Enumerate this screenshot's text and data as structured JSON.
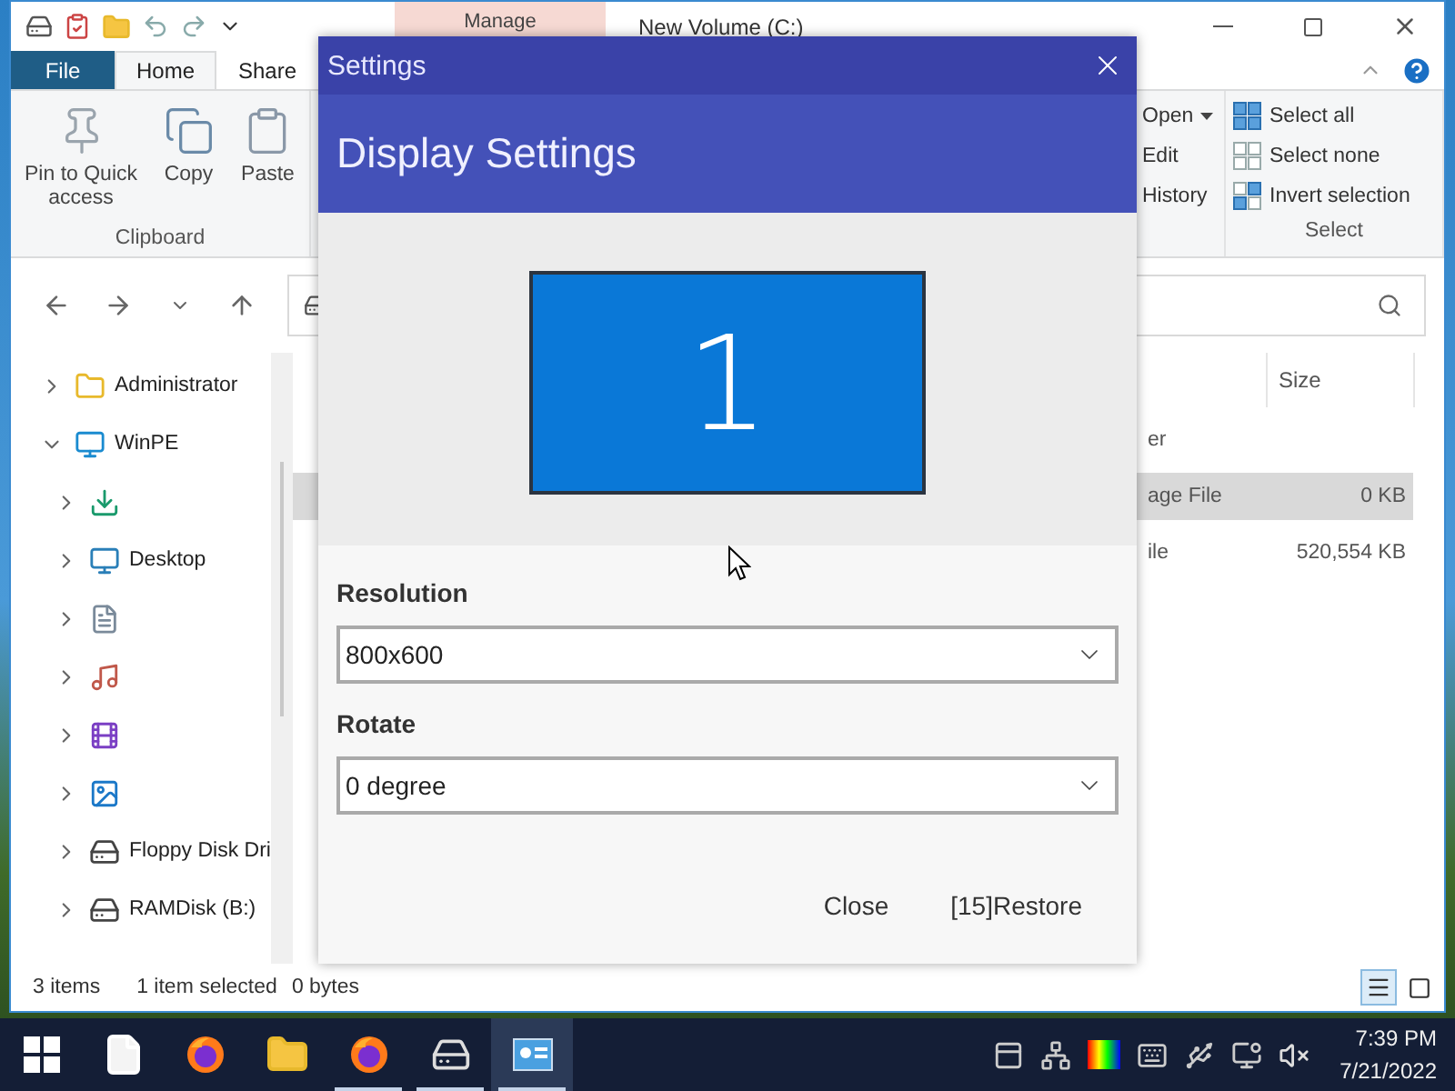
{
  "explorer": {
    "title": "New Volume (C:)",
    "context_tab": "Manage",
    "ribbon_tabs": [
      {
        "label": "File",
        "kind": "backstage",
        "selected": false
      },
      {
        "label": "Home",
        "kind": "tab",
        "selected": true
      },
      {
        "label": "Share",
        "kind": "tab",
        "selected": false
      }
    ],
    "clipboard_group": {
      "name": "Clipboard",
      "buttons": [
        {
          "label": "Pin to Quick access",
          "kind": "pin"
        },
        {
          "label": "Copy",
          "kind": "copy"
        },
        {
          "label": "Paste",
          "kind": "paste"
        }
      ]
    },
    "open_group": {
      "buttons": [
        {
          "label": "Open",
          "kind": "dropdown"
        },
        {
          "label": "Edit",
          "kind": "plain"
        },
        {
          "label": "History",
          "kind": "plain"
        }
      ]
    },
    "select_group": {
      "name": "Select",
      "buttons": [
        {
          "label": "Select all",
          "kind": "all"
        },
        {
          "label": "Select none",
          "kind": "none"
        },
        {
          "label": "Invert selection",
          "kind": "invert"
        }
      ]
    },
    "nav_tree": [
      {
        "label": "Administrator",
        "kind": "folder",
        "expanded": false
      },
      {
        "label": "WinPE",
        "kind": "computer",
        "expanded": true,
        "children": [
          {
            "kind": "downloads",
            "expanded": false
          },
          {
            "label": "Desktop",
            "kind": "desktop",
            "expanded": false
          },
          {
            "kind": "documents",
            "expanded": false
          },
          {
            "kind": "music",
            "expanded": false
          },
          {
            "kind": "videos",
            "expanded": false
          },
          {
            "kind": "pictures",
            "expanded": false
          },
          {
            "label": "Floppy Disk Dri",
            "kind": "floppy",
            "expanded": false
          },
          {
            "label": "RAMDisk (B:)",
            "kind": "drive",
            "expanded": false
          }
        ]
      }
    ],
    "columns": [
      {
        "label": "Size"
      }
    ],
    "rows": [
      {
        "name": "er",
        "selected": false
      },
      {
        "name": "age File",
        "size": "0 KB",
        "selected": true
      },
      {
        "name": "ile",
        "size": "520,554 KB",
        "selected": false
      }
    ],
    "status_bar": {
      "item_count": "3 items",
      "selection": "1 item selected",
      "selection_size": "0 bytes"
    },
    "view_buttons": [
      {
        "kind": "details",
        "selected": true
      },
      {
        "kind": "large-icons",
        "selected": false
      }
    ]
  },
  "dialog": {
    "title": "Settings",
    "heading": "Display Settings",
    "monitor_number": "1",
    "fields": [
      {
        "label": "Resolution",
        "value": "800x600"
      },
      {
        "label": "Rotate",
        "value": "0 degree"
      }
    ],
    "buttons": [
      "Close",
      "[15]Restore"
    ]
  },
  "taskbar": {
    "apps": [
      {
        "kind": "start",
        "running": false,
        "active": false
      },
      {
        "kind": "file",
        "running": false,
        "active": false
      },
      {
        "kind": "firefox",
        "running": false,
        "active": false
      },
      {
        "kind": "explorer",
        "running": false,
        "active": false
      },
      {
        "kind": "firefox",
        "running": true,
        "active": false
      },
      {
        "kind": "drive",
        "running": true,
        "active": false
      },
      {
        "kind": "settings",
        "running": true,
        "active": true
      }
    ],
    "tray": [
      {
        "kind": "panel"
      },
      {
        "kind": "network"
      },
      {
        "kind": "color"
      },
      {
        "kind": "keyboard"
      },
      {
        "kind": "usb"
      },
      {
        "kind": "lan"
      },
      {
        "kind": "mute"
      }
    ],
    "time": "7:39 PM",
    "date": "7/21/2022"
  }
}
